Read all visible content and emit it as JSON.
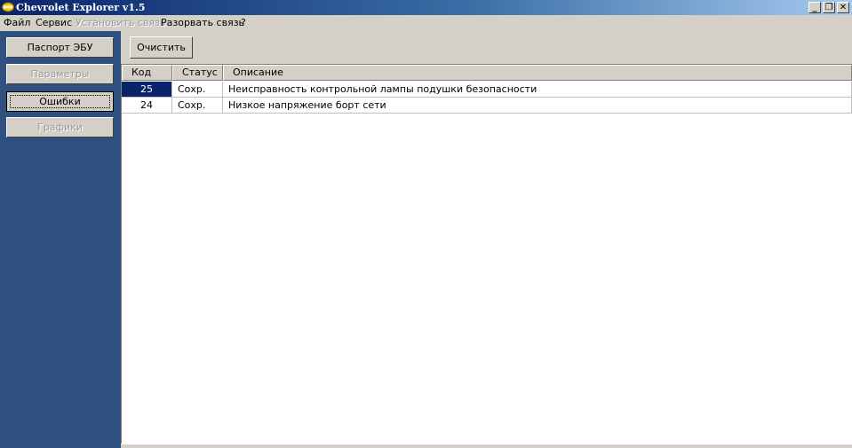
{
  "window": {
    "title": "Chevrolet Explorer v1.5",
    "controls": {
      "minimize": "_",
      "restore": "❐",
      "close": "✕"
    }
  },
  "menu": {
    "items": [
      {
        "label": "Файл",
        "enabled": true
      },
      {
        "label": "Сервис",
        "enabled": true
      },
      {
        "label": "Установить связь",
        "enabled": false
      },
      {
        "label": "Разорвать связь",
        "enabled": true
      },
      {
        "label": "?",
        "enabled": true
      }
    ]
  },
  "sidebar": {
    "buttons": [
      {
        "label": "Паспорт ЭБУ",
        "enabled": true,
        "active": false
      },
      {
        "label": "Параметры",
        "enabled": false,
        "active": false
      },
      {
        "label": "Ошибки",
        "enabled": true,
        "active": true
      },
      {
        "label": "Графики",
        "enabled": false,
        "active": false
      }
    ]
  },
  "toolbar": {
    "clear_label": "Очистить"
  },
  "grid": {
    "columns": [
      "Код",
      "Статус",
      "Описание"
    ],
    "rows": [
      {
        "code": "25",
        "status": "Сохр.",
        "description": "Неисправность контрольной лампы подушки безопасности",
        "selected": true
      },
      {
        "code": "24",
        "status": "Сохр.",
        "description": "Низкое напряжение борт сети",
        "selected": false
      }
    ]
  },
  "colors": {
    "sidebar_bg": "#2f5180",
    "titlebar_start": "#0a246a",
    "titlebar_end": "#a6caf0",
    "selection": "#0a246a",
    "face": "#d4d0c8"
  },
  "icons": {
    "app": "chevrolet-logo-icon"
  }
}
